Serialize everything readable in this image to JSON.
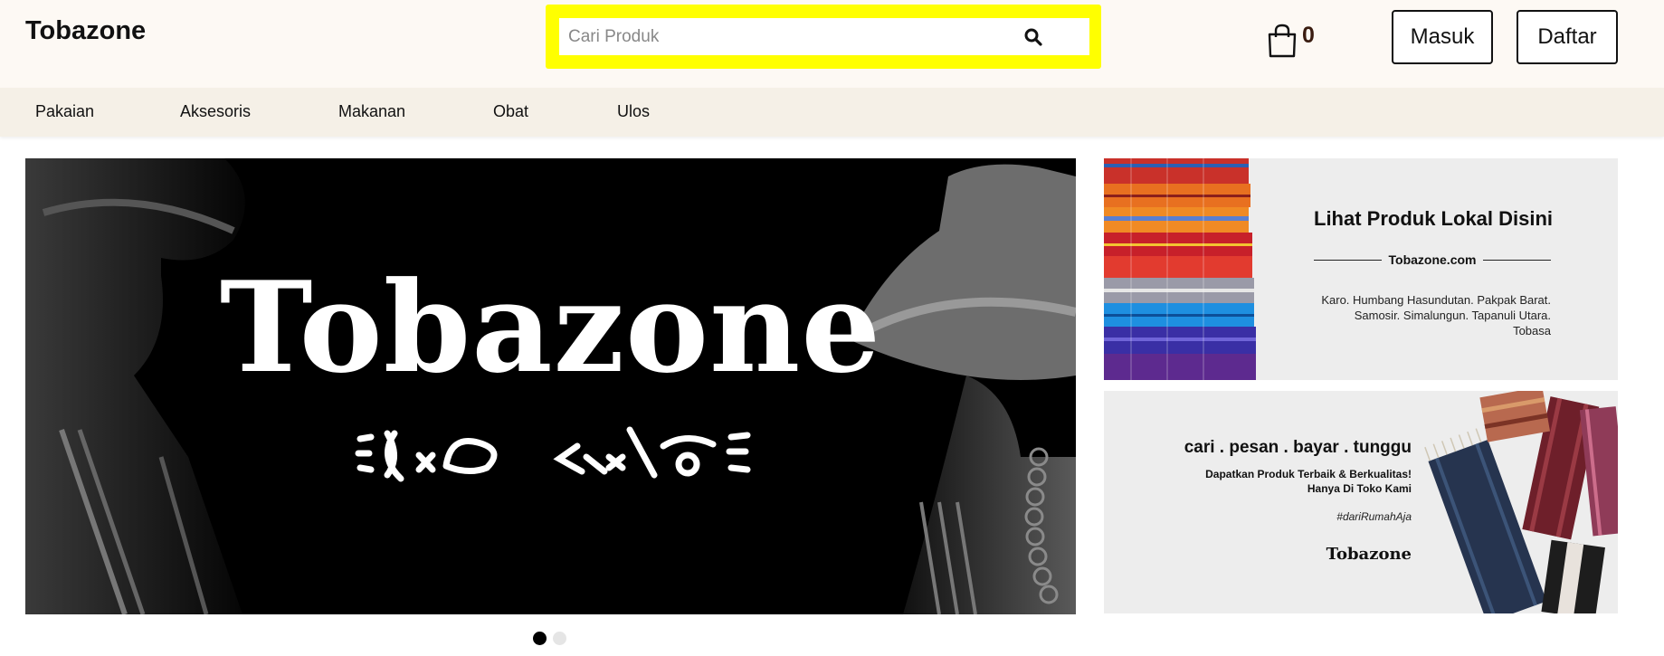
{
  "header": {
    "logo": "Tobazone",
    "search_placeholder": "Cari Produk",
    "search_icon": "magnifier-icon",
    "cart_icon": "shopping-bag-icon",
    "cart_count": "0",
    "login_label": "Masuk",
    "register_label": "Daftar",
    "search_highlight_color": "#ffff00"
  },
  "nav": {
    "items": [
      {
        "label": "Pakaian"
      },
      {
        "label": "Aksesoris"
      },
      {
        "label": "Makanan"
      },
      {
        "label": "Obat"
      },
      {
        "label": "Ulos"
      }
    ]
  },
  "hero": {
    "title": "Tobazone",
    "script_text": "batak-script-glyphs",
    "active_slide": 1,
    "slide_count": 2
  },
  "banners": {
    "banner1": {
      "title": "Lihat Produk Lokal Disini",
      "url": "Tobazone.com",
      "text_line1": "Karo. Humbang Hasundutan. Pakpak Barat.",
      "text_line2": "Samosir. Simalungun. Tapanuli Utara. Tobasa"
    },
    "banner2": {
      "headline": "cari . pesan . bayar . tunggu",
      "sub_line1": "Dapatkan Produk Terbaik & Berkualitas!",
      "sub_line2": "Hanya Di Toko Kami",
      "hashtag": "#dariRumahAja",
      "brand": "Tobazone"
    }
  }
}
